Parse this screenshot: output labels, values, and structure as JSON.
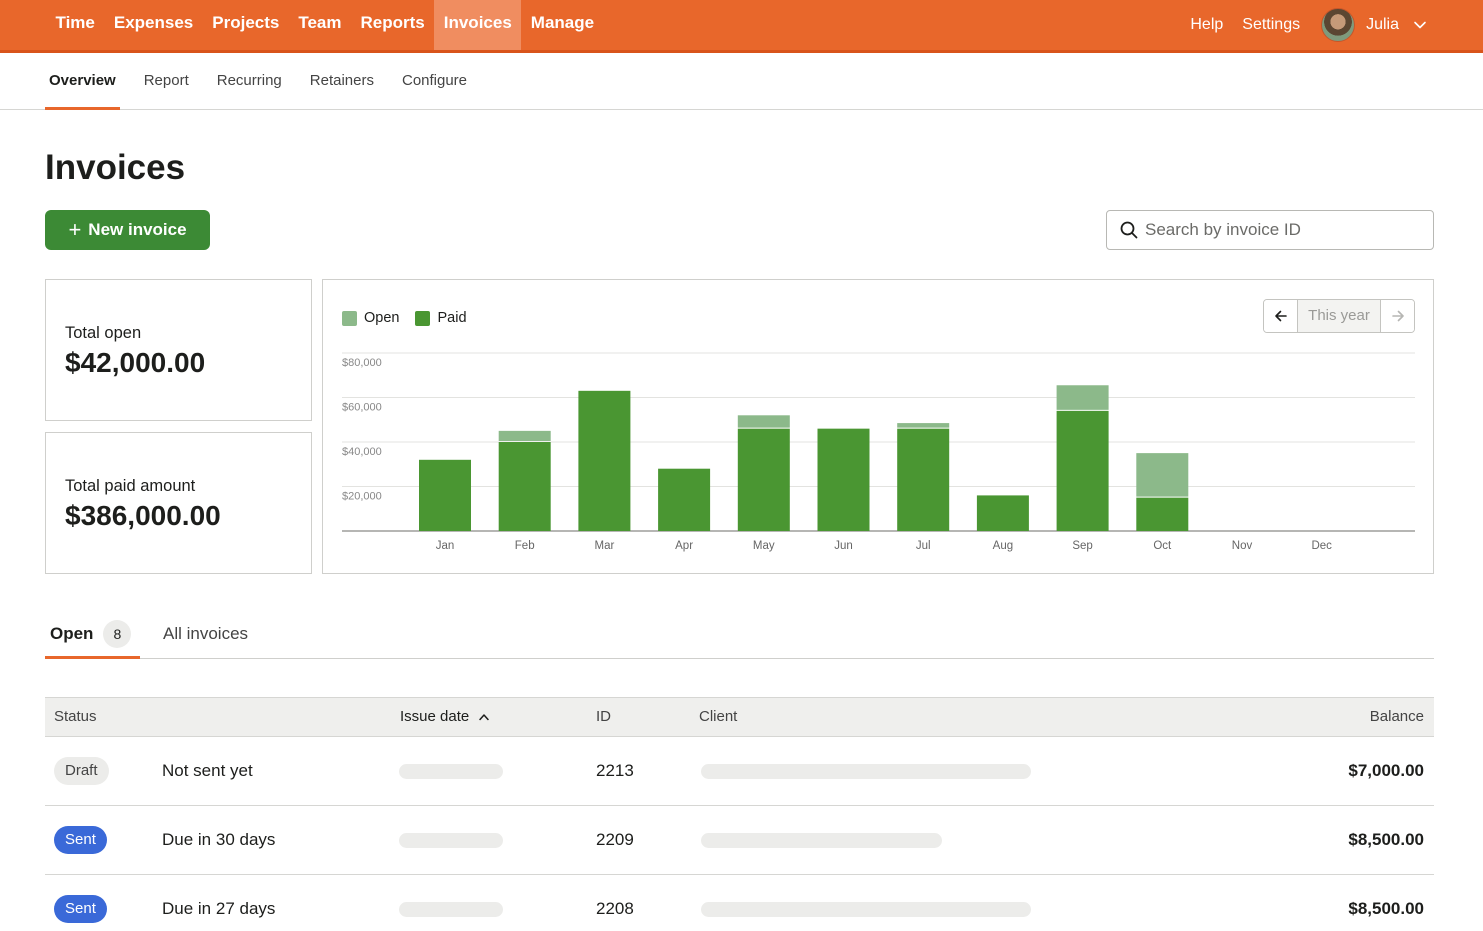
{
  "topnav": {
    "items": [
      {
        "label": "Time",
        "active": false
      },
      {
        "label": "Expenses",
        "active": false
      },
      {
        "label": "Projects",
        "active": false
      },
      {
        "label": "Team",
        "active": false
      },
      {
        "label": "Reports",
        "active": false
      },
      {
        "label": "Invoices",
        "active": true
      },
      {
        "label": "Manage",
        "active": false
      }
    ],
    "help": "Help",
    "settings": "Settings",
    "user": "Julia"
  },
  "subnav": {
    "items": [
      {
        "label": "Overview",
        "active": true
      },
      {
        "label": "Report",
        "active": false
      },
      {
        "label": "Recurring",
        "active": false
      },
      {
        "label": "Retainers",
        "active": false
      },
      {
        "label": "Configure",
        "active": false
      }
    ]
  },
  "page": {
    "title": "Invoices",
    "new_button": "New invoice",
    "search_placeholder": "Search by invoice ID"
  },
  "stats": {
    "open_label": "Total open",
    "open_value": "$42,000.00",
    "paid_label": "Total paid amount",
    "paid_value": "$386,000.00"
  },
  "chart_nav": {
    "label": "This year"
  },
  "chart_data": {
    "type": "bar",
    "stacked": true,
    "categories": [
      "Jan",
      "Feb",
      "Mar",
      "Apr",
      "May",
      "Jun",
      "Jul",
      "Aug",
      "Sep",
      "Oct",
      "Nov",
      "Dec"
    ],
    "series": [
      {
        "name": "Paid",
        "color": "#4a9632",
        "values": [
          32000,
          40000,
          63000,
          28000,
          46000,
          46000,
          46000,
          16000,
          54000,
          15000,
          0,
          0
        ]
      },
      {
        "name": "Open",
        "color": "#8cb98a",
        "values": [
          0,
          5000,
          0,
          0,
          6000,
          0,
          2500,
          0,
          11500,
          20000,
          0,
          0
        ]
      }
    ],
    "yticks": [
      20000,
      40000,
      60000,
      80000
    ],
    "ytick_labels": [
      "$20,000",
      "$40,000",
      "$60,000",
      "$80,000"
    ],
    "ylim": [
      0,
      80000
    ],
    "grid": true,
    "legend": "top-left"
  },
  "tabs": {
    "open_label": "Open",
    "open_count": "8",
    "all_label": "All invoices"
  },
  "table": {
    "headers": {
      "status": "Status",
      "issue_date": "Issue date",
      "id": "ID",
      "client": "Client",
      "balance": "Balance"
    },
    "rows": [
      {
        "status": "Draft",
        "due": "Not sent yet",
        "id": "2213",
        "balance": "$7,000.00"
      },
      {
        "status": "Sent",
        "due": "Due in 30 days",
        "id": "2209",
        "balance": "$8,500.00"
      },
      {
        "status": "Sent",
        "due": "Due in 27 days",
        "id": "2208",
        "balance": "$8,500.00"
      }
    ]
  }
}
